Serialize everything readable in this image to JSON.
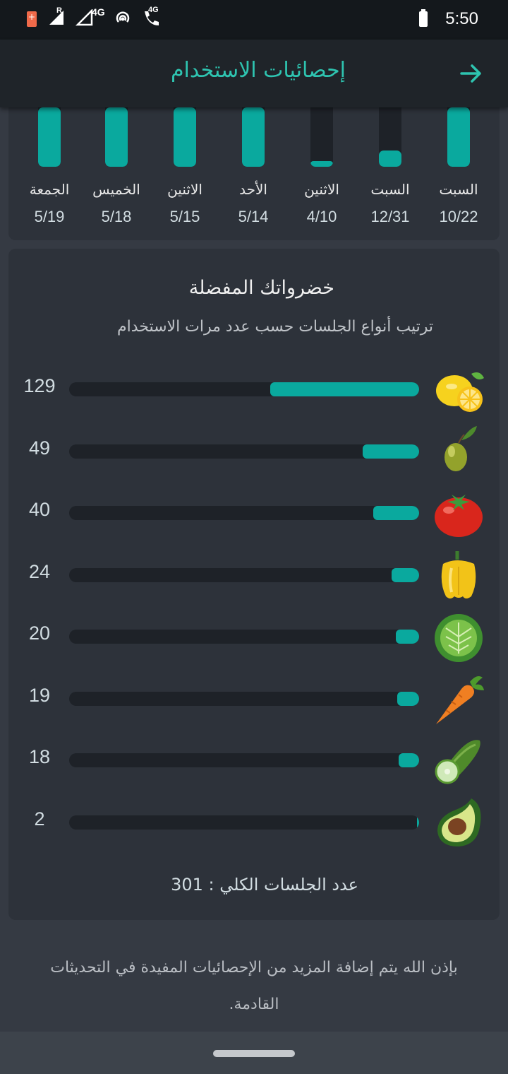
{
  "status_bar": {
    "time": "5:50",
    "network_label_1": "4G",
    "network_label_2": "4G",
    "roaming_label": "R",
    "icons": [
      "battery-saver-icon",
      "signal-icon",
      "signal-outline-icon",
      "hotspot-icon",
      "wifi-call-icon",
      "battery-icon"
    ]
  },
  "app_bar": {
    "title": "إحصائيات الاستخدام",
    "back_icon": "arrow-right-icon",
    "accent_color": "#2ec4b0"
  },
  "weekly_usage": {
    "bar_color": "#0aa99e",
    "days": [
      {
        "day": "السبت",
        "date": "10/22",
        "level": 1.0
      },
      {
        "day": "السبت",
        "date": "12/31",
        "level": 0.27
      },
      {
        "day": "الاثنين",
        "date": "4/10",
        "level": 0.09
      },
      {
        "day": "الأحد",
        "date": "5/14",
        "level": 1.0
      },
      {
        "day": "الاثنين",
        "date": "5/15",
        "level": 1.0
      },
      {
        "day": "الخميس",
        "date": "5/18",
        "level": 1.0
      },
      {
        "day": "الجمعة",
        "date": "5/19",
        "level": 1.0
      }
    ]
  },
  "favorites": {
    "title": "خضرواتك المفضلة",
    "subtitle": "ترتيب أنواع الجلسات حسب عدد مرات الاستخدام",
    "max_count": 129,
    "items": [
      {
        "icon": "lemon-icon",
        "count": "129",
        "value": 129
      },
      {
        "icon": "olive-icon",
        "count": "49",
        "value": 49
      },
      {
        "icon": "tomato-icon",
        "count": "40",
        "value": 40
      },
      {
        "icon": "bell-pepper-icon",
        "count": "24",
        "value": 24
      },
      {
        "icon": "cabbage-icon",
        "count": "20",
        "value": 20
      },
      {
        "icon": "carrot-icon",
        "count": "19",
        "value": 19
      },
      {
        "icon": "cucumber-icon",
        "count": "18",
        "value": 18
      },
      {
        "icon": "avocado-icon",
        "count": "2",
        "value": 2
      }
    ],
    "total_text": "عدد الجلسات الكلي : 301"
  },
  "footer": {
    "note": "بإذن الله يتم إضافة المزيد من الإحصائيات المفيدة في التحديثات القادمة."
  }
}
